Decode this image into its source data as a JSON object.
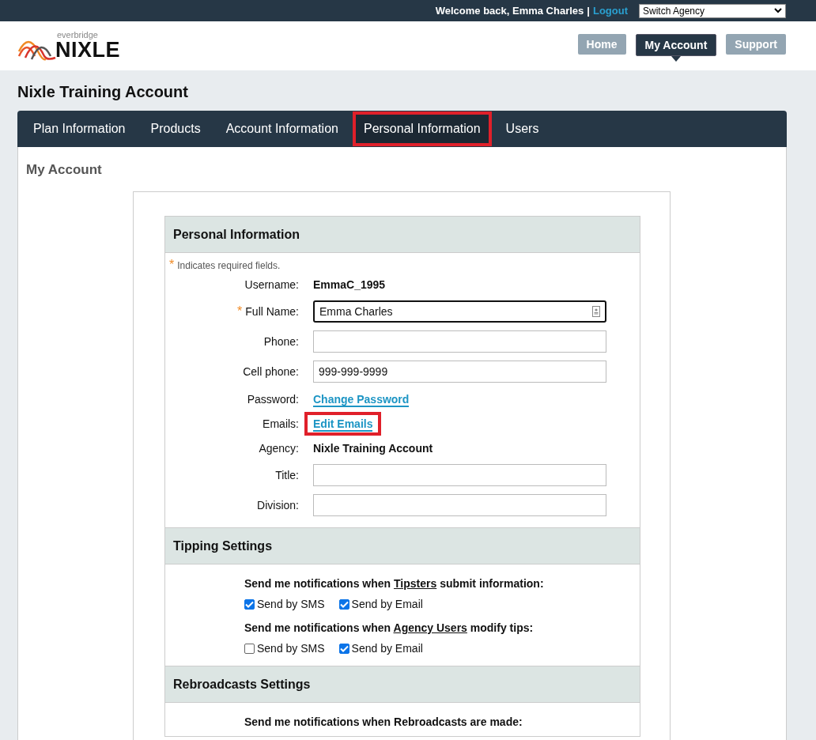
{
  "top_bar": {
    "welcome": "Welcome back, Emma Charles",
    "separator": "|",
    "logout": "Logout",
    "agency_select": "Switch Agency"
  },
  "header": {
    "logo": {
      "small": "everbridge",
      "large": "NIXLE"
    },
    "nav": [
      {
        "label": "Home",
        "selected": false
      },
      {
        "label": "My Account",
        "selected": true
      },
      {
        "label": "Support",
        "selected": false
      }
    ]
  },
  "page_title": "Nixle Training Account",
  "tabs": [
    {
      "label": "Plan Information",
      "highlighted": false
    },
    {
      "label": "Products",
      "highlighted": false
    },
    {
      "label": "Account Information",
      "highlighted": false
    },
    {
      "label": "Personal Information",
      "highlighted": true
    },
    {
      "label": "Users",
      "highlighted": false
    }
  ],
  "section_heading": "My Account",
  "personal_information": {
    "title": "Personal Information",
    "required_note": {
      "mark": "*",
      "text": "Indicates required fields."
    },
    "rows": [
      {
        "kind": "text",
        "label": "Username:",
        "required": false,
        "value": "EmmaC_1995"
      },
      {
        "kind": "input",
        "label": "Full Name:",
        "required": true,
        "value": "Emma Charles",
        "focused": true
      },
      {
        "kind": "input",
        "label": "Phone:",
        "required": false,
        "focused": false
      },
      {
        "kind": "input",
        "label": "Cell phone:",
        "required": false,
        "value": "999-999-9999",
        "focused": false
      },
      {
        "kind": "link",
        "label": "Password:",
        "required": false,
        "value": "Change Password",
        "highlighted": false
      },
      {
        "kind": "link",
        "label": "Emails:",
        "required": false,
        "value": "Edit Emails",
        "highlighted": true
      },
      {
        "kind": "text",
        "label": "Agency:",
        "required": false,
        "value": "Nixle Training Account"
      },
      {
        "kind": "input",
        "label": "Title:",
        "required": false,
        "focused": false
      },
      {
        "kind": "input",
        "label": "Division:",
        "required": false,
        "focused": false
      }
    ]
  },
  "tipping_settings": {
    "title": "Tipping Settings",
    "groups": [
      {
        "prompt": {
          "before": "Send me notifications when ",
          "link": "Tipsters",
          "after": " submit information:"
        },
        "options": [
          {
            "label": "Send by SMS",
            "checked": true
          },
          {
            "label": "Send by Email",
            "checked": true
          }
        ]
      },
      {
        "prompt": {
          "before": "Send me notifications when ",
          "link": "Agency Users",
          "after": " modify tips:"
        },
        "options": [
          {
            "label": "Send by SMS",
            "checked": false
          },
          {
            "label": "Send by Email",
            "checked": true
          }
        ]
      }
    ]
  },
  "rebroadcasts_settings": {
    "title": "Rebroadcasts Settings",
    "prompt": "Send me notifications when Rebroadcasts are made:"
  }
}
